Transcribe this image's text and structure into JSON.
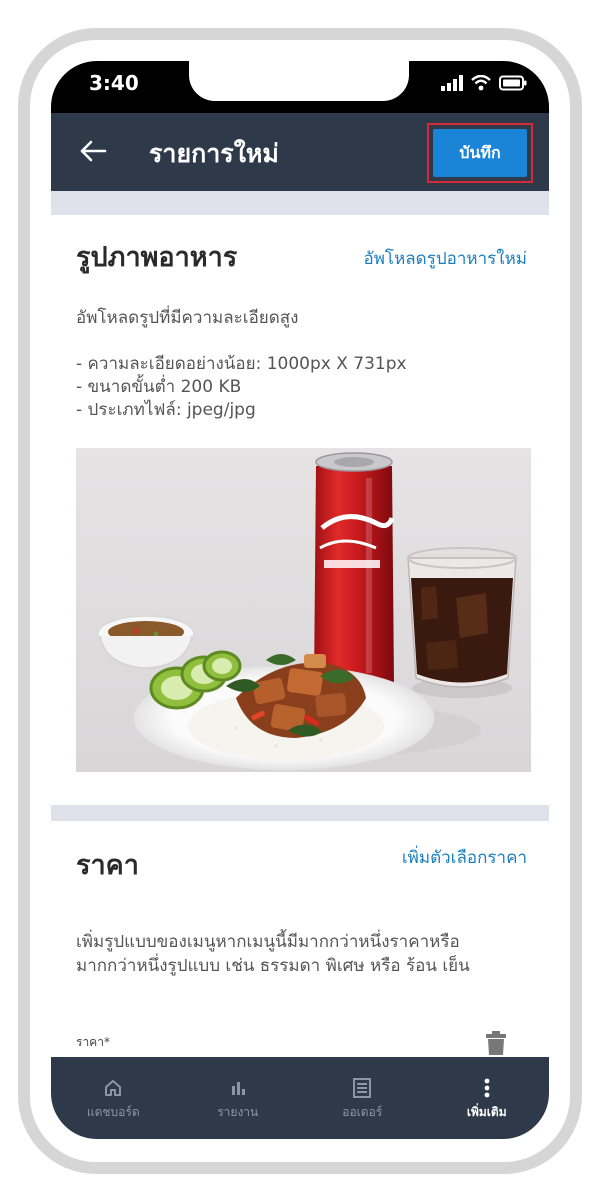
{
  "status_bar": {
    "time": "3:40"
  },
  "header": {
    "title": "รายการใหม่",
    "save_label": "บันทึก"
  },
  "food_image_section": {
    "title": "รูปภาพอาหาร",
    "upload_link": "อัพโหลดรูปอาหารใหม่",
    "description": "อัพโหลดรูปที่มีความละเอียดสูง",
    "requirements": [
      "-  ความละเอียดอย่างน้อย: 1000px X 731px",
      "-  ขนาดขั้นต่ำ 200 KB",
      "- ประเภทไฟล์: jpeg/jpg"
    ]
  },
  "price_section": {
    "title": "ราคา",
    "add_option_link": "เพิ่มตัวเลือกราคา",
    "description_lines": [
      "เพิ่มรูปแบบของเมนูหากเมนูนี้มีมากกว่าหนึ่งราคาหรือ",
      "มากกว่าหนึ่งรูปแบบ เช่น ธรรมดา พิเศษ หรือ ร้อน เย็น"
    ],
    "price_field_label": "ราคา*"
  },
  "bottom_nav": {
    "items": [
      {
        "label": "แดชบอร์ด",
        "icon": "home-icon"
      },
      {
        "label": "รายงาน",
        "icon": "bar-chart-icon"
      },
      {
        "label": "ออเดอร์",
        "icon": "list-icon"
      },
      {
        "label": "เพิ่มเติม",
        "icon": "more-vertical-icon"
      }
    ],
    "active_index": 3
  },
  "colors": {
    "header_bg": "#2e3a4a",
    "accent_blue": "#1a84d6",
    "link_blue": "#1a7fbf",
    "highlight_red": "#d22a36",
    "page_bg": "#dfe2ea"
  }
}
